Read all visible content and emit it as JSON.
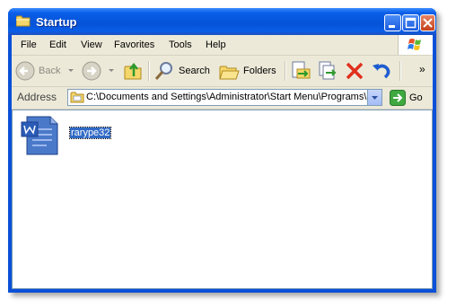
{
  "window": {
    "title": "Startup"
  },
  "menu": [
    "File",
    "Edit",
    "View",
    "Favorites",
    "Tools",
    "Help"
  ],
  "toolbar": {
    "back_label": "Back",
    "search_label": "Search",
    "folders_label": "Folders",
    "overflow": "»"
  },
  "address": {
    "label": "Address",
    "value": "C:\\Documents and Settings\\Administrator\\Start Menu\\Programs\\S",
    "go_label": "Go"
  },
  "files": [
    {
      "name": "rarype32",
      "icon": "word-document-icon",
      "selected": true
    }
  ],
  "colors": {
    "title_bar": "#0553d8",
    "selection": "#316ac5",
    "close_button": "#c3401b",
    "frame": "#ece9d8"
  }
}
